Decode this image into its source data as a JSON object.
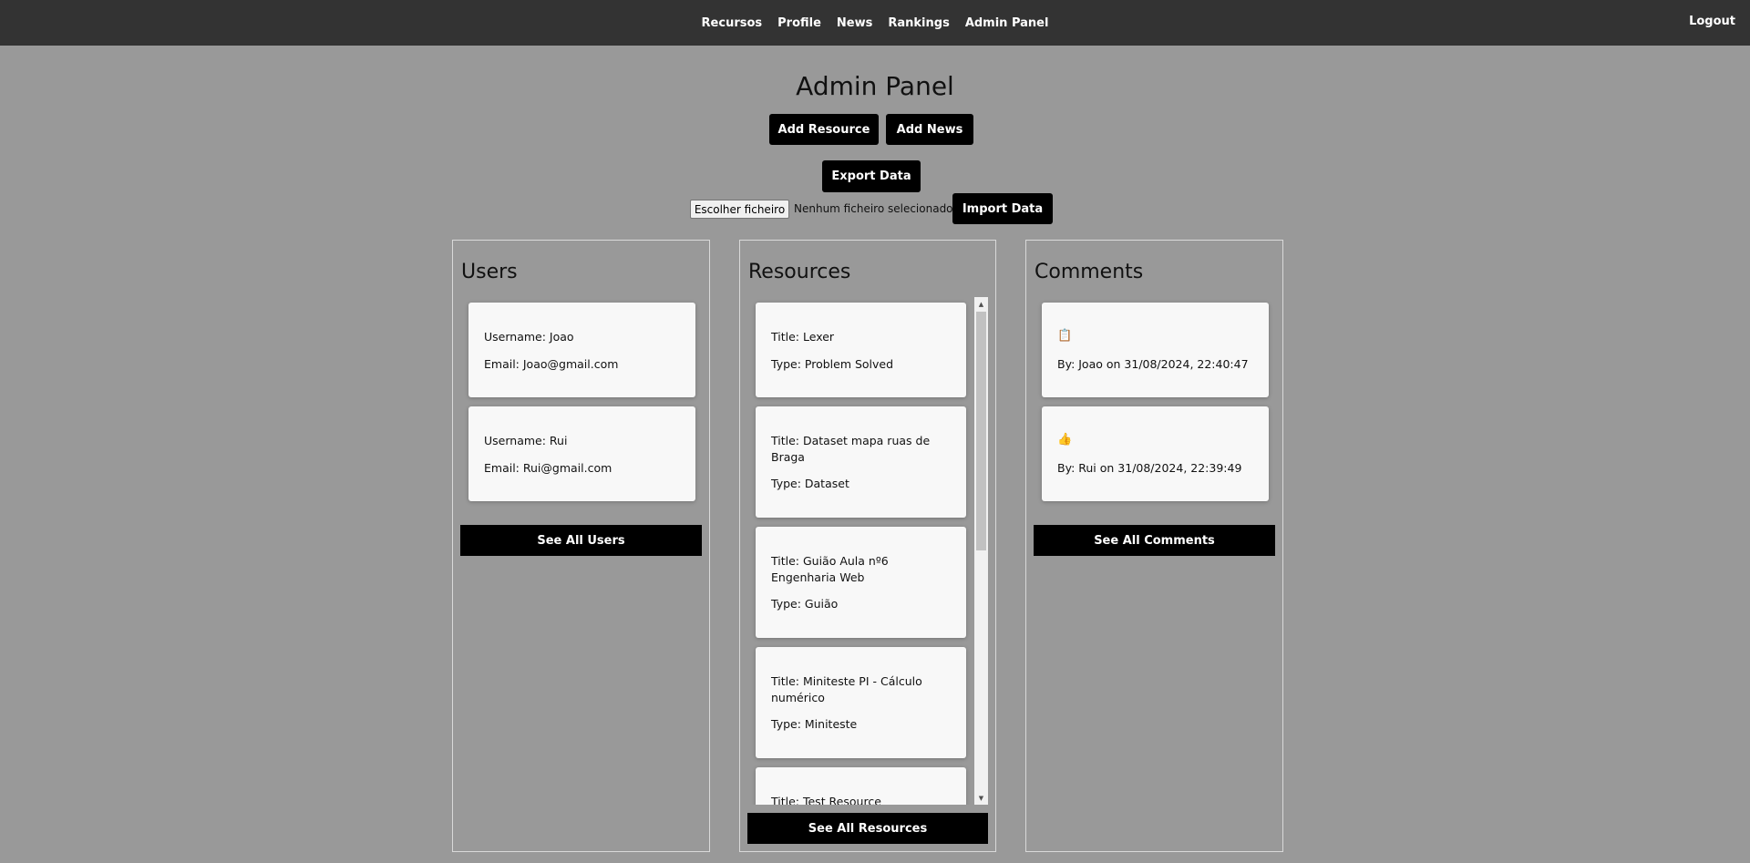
{
  "nav": {
    "links": [
      "Recursos",
      "Profile",
      "News",
      "Rankings",
      "Admin Panel"
    ],
    "logout": "Logout"
  },
  "header": {
    "title": "Admin Panel",
    "add_resource": "Add Resource",
    "add_news": "Add News",
    "export": "Export Data",
    "choose_file": "Escolher ficheiro",
    "no_file": "Nenhum ficheiro selecionado",
    "import": "Import Data"
  },
  "users": {
    "title": "Users",
    "items": [
      {
        "username": "Username: Joao",
        "email": "Email: Joao@gmail.com"
      },
      {
        "username": "Username: Rui",
        "email": "Email: Rui@gmail.com"
      }
    ],
    "see_all": "See All Users"
  },
  "resources": {
    "title": "Resources",
    "items": [
      {
        "title": "Title: Lexer",
        "type": "Type: Problem Solved"
      },
      {
        "title": "Title: Dataset mapa ruas de Braga",
        "type": "Type: Dataset"
      },
      {
        "title": "Title: Guião Aula nº6 Engenharia Web",
        "type": "Type: Guião"
      },
      {
        "title": "Title: Miniteste PI - Cálculo numérico",
        "type": "Type: Miniteste"
      },
      {
        "title": "Title: Test Resource",
        "type": ""
      }
    ],
    "see_all": "See All Resources"
  },
  "comments": {
    "title": "Comments",
    "items": [
      {
        "icon": "clipboard-icon",
        "glyph": "📋",
        "by": "By: Joao on 31/08/2024, 22:40:47"
      },
      {
        "icon": "thumbs-up-icon",
        "glyph": "👍",
        "by": "By: Rui on 31/08/2024, 22:39:49"
      }
    ],
    "see_all": "See All Comments"
  }
}
